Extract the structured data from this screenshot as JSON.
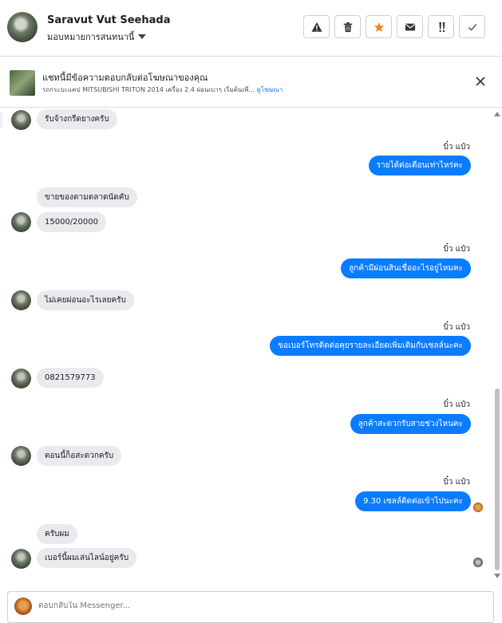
{
  "header": {
    "name": "Saravut Vut Seehada",
    "assign_label": "มอบหมายการสนทนานี้",
    "actions": [
      "warning-icon",
      "trash-icon",
      "star-icon",
      "mail-icon",
      "important-icon",
      "check-icon"
    ],
    "star_color": "#f5821f"
  },
  "ad": {
    "title": "แชทนี้มีข้อความตอบกลับต่อโฆษณาของคุณ",
    "subtitle": "รถกระบะแคป MITSUBISHI TRITON 2014 เครื่อง 2.4 ผ่อนเบาๆ เริ่มต้นเพี...",
    "link": "ดูโฆษณา"
  },
  "messages": [
    {
      "dir": "in",
      "text": "รับจ้างกรีดยางครับ"
    },
    {
      "dir": "out",
      "sender": "บิ๋ว แป๋ว",
      "text": "รายได้ต่อเดือนเท่าไหร่คะ"
    },
    {
      "dir": "in",
      "text": "ขายของตามตลาดนัดคับ"
    },
    {
      "dir": "in",
      "text": "15000/20000"
    },
    {
      "dir": "out",
      "sender": "บิ๋ว แป๋ว",
      "text": "ลูกค้ามีผ่อนสินเชื่ออะไรอยู่ไหมคะ"
    },
    {
      "dir": "in",
      "text": "ไม่เคยผ่อนอะไรเลยครับ"
    },
    {
      "dir": "out",
      "sender": "บิ๋ว แป๋ว",
      "text": "ขอเบอร์โทรติดต่อคุยรายละเอียดเพิ่มเติมกับเซลล์นะคะ"
    },
    {
      "dir": "in",
      "text": "0821579773"
    },
    {
      "dir": "out",
      "sender": "บิ๋ว แป๋ว",
      "text": "ลูกค้าสะดวกรับสายช่วงไหนคะ"
    },
    {
      "dir": "in",
      "text": "ตอนนี้ก็อสะดวกครับ"
    },
    {
      "dir": "out",
      "sender": "บิ๋ว แป๋ว",
      "text": "9.30  เซลล์ติดต่อเข้าไปนะคะ"
    },
    {
      "dir": "in",
      "text": "ครับผม"
    },
    {
      "dir": "in",
      "text": "เบอร์นี้ผมเล่นไลน์อยู่ครับ"
    }
  ],
  "composer": {
    "placeholder": "ตอบกลับใน Messenger..."
  },
  "colors": {
    "outgoing_bubble": "#0a7cff",
    "incoming_bubble": "#e9eaed"
  }
}
